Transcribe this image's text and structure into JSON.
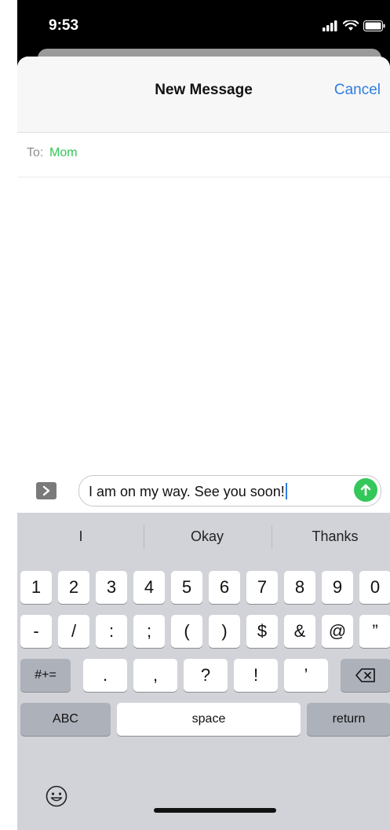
{
  "status_bar": {
    "time": "9:53"
  },
  "header": {
    "title": "New Message",
    "cancel_label": "Cancel"
  },
  "recipient": {
    "label": "To:",
    "name": "Mom"
  },
  "composer": {
    "message_text": "I am on my way. See you soon!"
  },
  "suggestions": [
    "I",
    "Okay",
    "Thanks"
  ],
  "keyboard": {
    "row1": [
      "1",
      "2",
      "3",
      "4",
      "5",
      "6",
      "7",
      "8",
      "9",
      "0"
    ],
    "row2": [
      "-",
      "/",
      ":",
      ";",
      "(",
      ")",
      "$",
      "&",
      "@",
      "”"
    ],
    "row3_mode": "#+=",
    "row3": [
      ".",
      ",",
      "?",
      "!",
      "’"
    ],
    "abc_label": "ABC",
    "space_label": "space",
    "return_label": "return"
  },
  "colors": {
    "accent_blue": "#2f7de1",
    "send_green": "#34c759",
    "keyboard_bg": "#d1d3d9"
  }
}
